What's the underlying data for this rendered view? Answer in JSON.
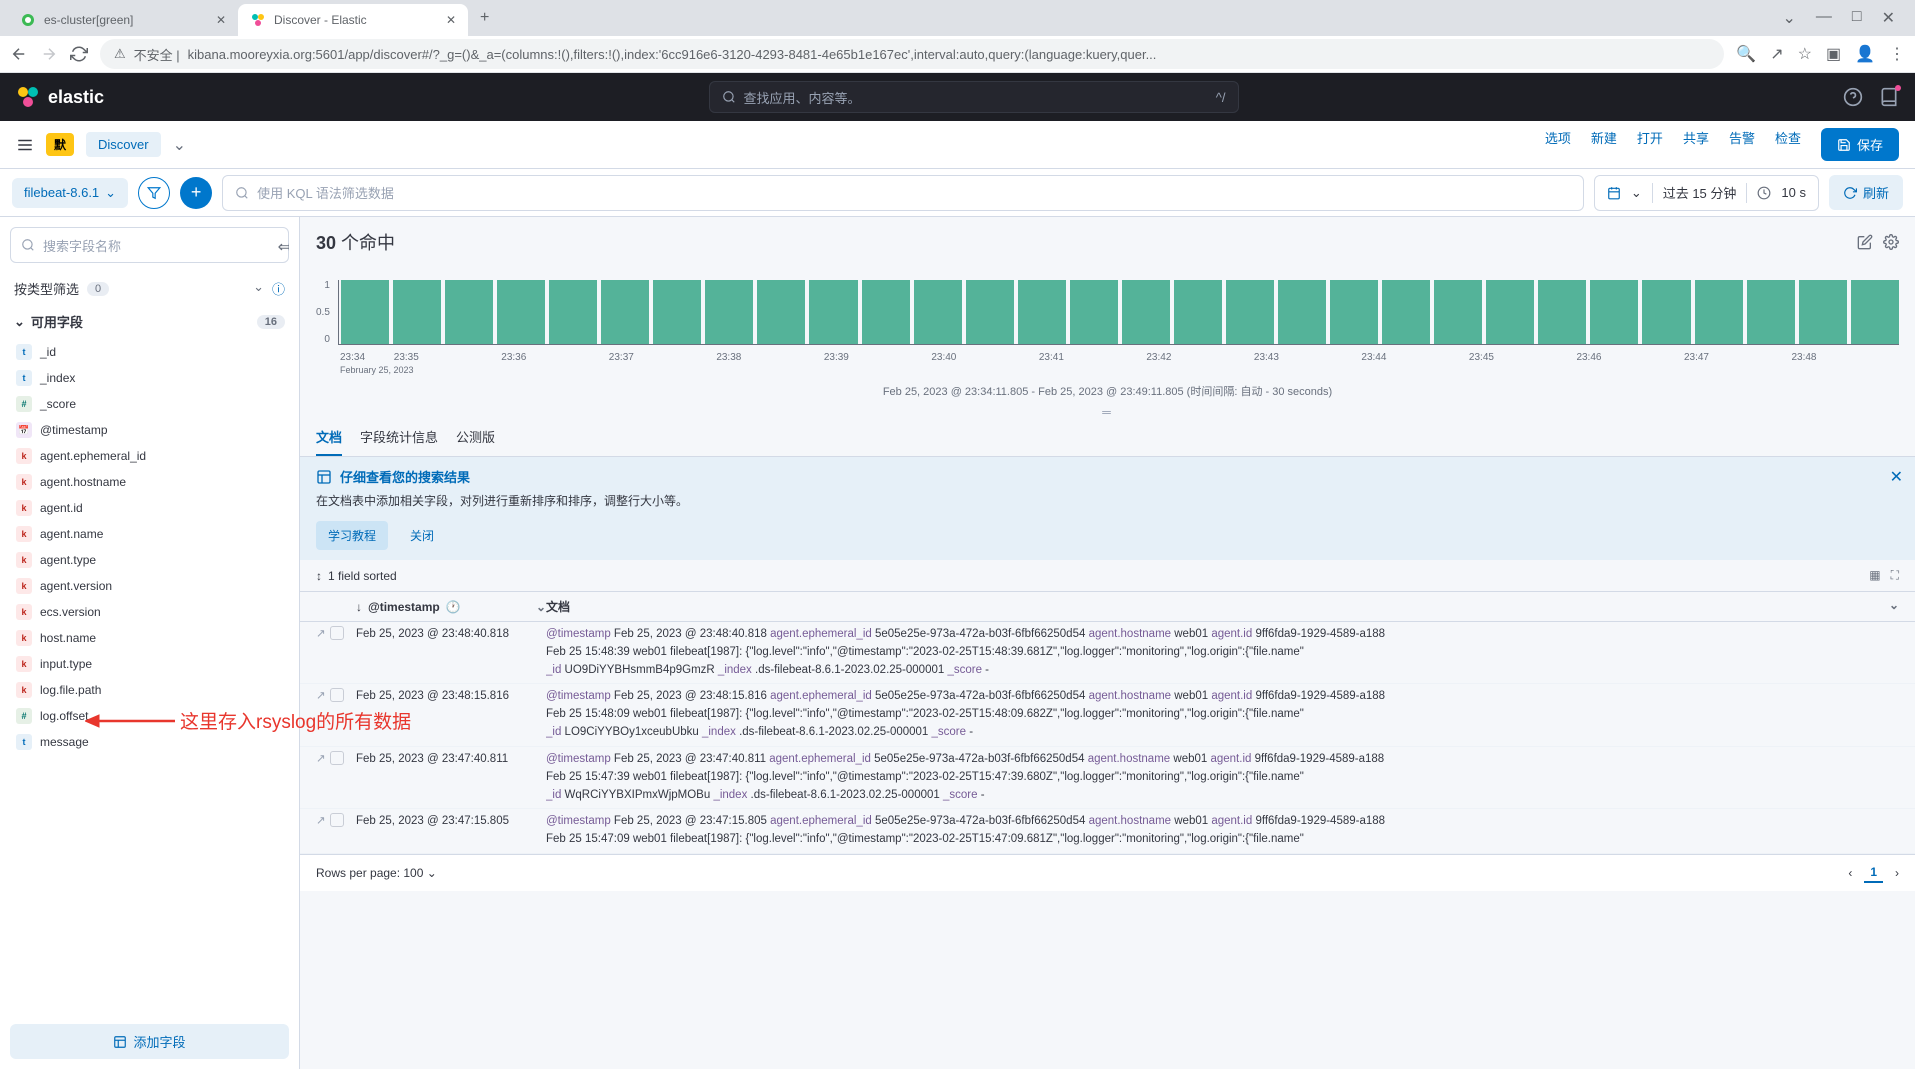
{
  "browser": {
    "tabs": [
      {
        "title": "es-cluster[green]",
        "active": false
      },
      {
        "title": "Discover - Elastic",
        "active": true
      }
    ],
    "url_prefix": "不安全 |",
    "url": "kibana.mooreyxia.org:5601/app/discover#/?_g=()&_a=(columns:!(),filters:!(),index:'6cc916e6-3120-4293-8481-4e65b1e167ec',interval:auto,query:(language:kuery,quer..."
  },
  "header": {
    "brand": "elastic",
    "search_placeholder": "查找应用、内容等。",
    "search_shortcut": "^/"
  },
  "app_bar": {
    "badge": "默",
    "app_name": "Discover",
    "links": [
      "选项",
      "新建",
      "打开",
      "共享",
      "告警",
      "检查"
    ],
    "save": "保存"
  },
  "query_bar": {
    "index_pattern": "filebeat-8.6.1",
    "kql_placeholder": "使用 KQL 语法筛选数据",
    "time_label": "过去 15 分钟",
    "refresh_interval": "10 s",
    "refresh_btn": "刷新"
  },
  "sidebar": {
    "search_placeholder": "搜索字段名称",
    "filter_label": "按类型筛选",
    "filter_count": "0",
    "available_label": "可用字段",
    "available_count": "16",
    "fields": [
      {
        "name": "_id",
        "token": "text"
      },
      {
        "name": "_index",
        "token": "text"
      },
      {
        "name": "_score",
        "token": "num"
      },
      {
        "name": "@timestamp",
        "token": "date"
      },
      {
        "name": "agent.ephemeral_id",
        "token": "key"
      },
      {
        "name": "agent.hostname",
        "token": "key"
      },
      {
        "name": "agent.id",
        "token": "key"
      },
      {
        "name": "agent.name",
        "token": "key"
      },
      {
        "name": "agent.type",
        "token": "key"
      },
      {
        "name": "agent.version",
        "token": "key"
      },
      {
        "name": "ecs.version",
        "token": "key"
      },
      {
        "name": "host.name",
        "token": "key"
      },
      {
        "name": "input.type",
        "token": "key"
      },
      {
        "name": "log.file.path",
        "token": "key"
      },
      {
        "name": "log.offset",
        "token": "num"
      },
      {
        "name": "message",
        "token": "text"
      }
    ],
    "add_field": "添加字段"
  },
  "content": {
    "hits_count": "30",
    "hits_label": "个命中",
    "caption": "Feb 25, 2023 @ 23:34:11.805 - Feb 25, 2023 @ 23:49:11.805   (时间间隔: 自动 - 30 seconds)"
  },
  "chart_data": {
    "type": "bar",
    "ylabel": "",
    "yticks": [
      0,
      0.5,
      1
    ],
    "ylim": [
      0,
      1
    ],
    "x_date": "February 25, 2023",
    "x_ticks": [
      "23:34",
      "23:35",
      "23:36",
      "23:37",
      "23:38",
      "23:39",
      "23:40",
      "23:41",
      "23:42",
      "23:43",
      "23:44",
      "23:45",
      "23:46",
      "23:47",
      "23:48"
    ],
    "values": [
      1,
      1,
      1,
      1,
      1,
      1,
      1,
      1,
      1,
      1,
      1,
      1,
      1,
      1,
      1,
      1,
      1,
      1,
      1,
      1,
      1,
      1,
      1,
      1,
      1,
      1,
      1,
      1,
      1,
      1
    ]
  },
  "doc_tabs": [
    "文档",
    "字段统计信息",
    "公测版"
  ],
  "callout": {
    "title": "仔细查看您的搜索结果",
    "desc": "在文档表中添加相关字段，对列进行重新排序和排序，调整行大小等。",
    "primary_btn": "学习教程",
    "text_btn": "关闭"
  },
  "table": {
    "sort_label": "1 field sorted",
    "col_timestamp": "@timestamp",
    "col_doc": "文档",
    "rows": [
      {
        "timestamp": "Feb 25, 2023 @ 23:48:40.818",
        "fields": [
          {
            "k": "@timestamp",
            "v": "Feb 25, 2023 @ 23:48:40.818"
          },
          {
            "k": "agent.ephemeral_id",
            "v": "5e05e25e-973a-472a-b03f-6fbf66250d54"
          },
          {
            "k": "agent.hostname",
            "v": "web01"
          },
          {
            "k": "agent.id",
            "v": "9ff6fda9-1929-4589-a188"
          }
        ],
        "line2": "Feb 25 15:48:39 web01 filebeat[1987]: {\"log.level\":\"info\",\"@timestamp\":\"2023-02-25T15:48:39.681Z\",\"log.logger\":\"monitoring\",\"log.origin\":{\"file.name\"",
        "line3_fields": [
          {
            "k": "_id",
            "v": "UO9DiYYBHsmmB4p9GmzR"
          },
          {
            "k": "_index",
            "v": ".ds-filebeat-8.6.1-2023.02.25-000001"
          },
          {
            "k": "_score",
            "v": "-"
          }
        ]
      },
      {
        "timestamp": "Feb 25, 2023 @ 23:48:15.816",
        "fields": [
          {
            "k": "@timestamp",
            "v": "Feb 25, 2023 @ 23:48:15.816"
          },
          {
            "k": "agent.ephemeral_id",
            "v": "5e05e25e-973a-472a-b03f-6fbf66250d54"
          },
          {
            "k": "agent.hostname",
            "v": "web01"
          },
          {
            "k": "agent.id",
            "v": "9ff6fda9-1929-4589-a188"
          }
        ],
        "line2": "Feb 25 15:48:09 web01 filebeat[1987]: {\"log.level\":\"info\",\"@timestamp\":\"2023-02-25T15:48:09.682Z\",\"log.logger\":\"monitoring\",\"log.origin\":{\"file.name\"",
        "line3_fields": [
          {
            "k": "_id",
            "v": "LO9CiYYBOy1xceubUbku"
          },
          {
            "k": "_index",
            "v": ".ds-filebeat-8.6.1-2023.02.25-000001"
          },
          {
            "k": "_score",
            "v": "-"
          }
        ]
      },
      {
        "timestamp": "Feb 25, 2023 @ 23:47:40.811",
        "fields": [
          {
            "k": "@timestamp",
            "v": "Feb 25, 2023 @ 23:47:40.811"
          },
          {
            "k": "agent.ephemeral_id",
            "v": "5e05e25e-973a-472a-b03f-6fbf66250d54"
          },
          {
            "k": "agent.hostname",
            "v": "web01"
          },
          {
            "k": "agent.id",
            "v": "9ff6fda9-1929-4589-a188"
          }
        ],
        "line2": "Feb 25 15:47:39 web01 filebeat[1987]: {\"log.level\":\"info\",\"@timestamp\":\"2023-02-25T15:47:39.680Z\",\"log.logger\":\"monitoring\",\"log.origin\":{\"file.name\"",
        "line3_fields": [
          {
            "k": "_id",
            "v": "WqRCiYYBXIPmxWjpMOBu"
          },
          {
            "k": "_index",
            "v": ".ds-filebeat-8.6.1-2023.02.25-000001"
          },
          {
            "k": "_score",
            "v": "-"
          }
        ]
      },
      {
        "timestamp": "Feb 25, 2023 @ 23:47:15.805",
        "fields": [
          {
            "k": "@timestamp",
            "v": "Feb 25, 2023 @ 23:47:15.805"
          },
          {
            "k": "agent.ephemeral_id",
            "v": "5e05e25e-973a-472a-b03f-6fbf66250d54"
          },
          {
            "k": "agent.hostname",
            "v": "web01"
          },
          {
            "k": "agent.id",
            "v": "9ff6fda9-1929-4589-a188"
          }
        ],
        "line2": "Feb 25 15:47:09 web01 filebeat[1987]: {\"log.level\":\"info\",\"@timestamp\":\"2023-02-25T15:47:09.681Z\",\"log.logger\":\"monitoring\",\"log.origin\":{\"file.name\""
      }
    ],
    "footer_label": "Rows per page: 100",
    "page": "1"
  },
  "annotation": {
    "text": "这里存入rsyslog的所有数据"
  }
}
